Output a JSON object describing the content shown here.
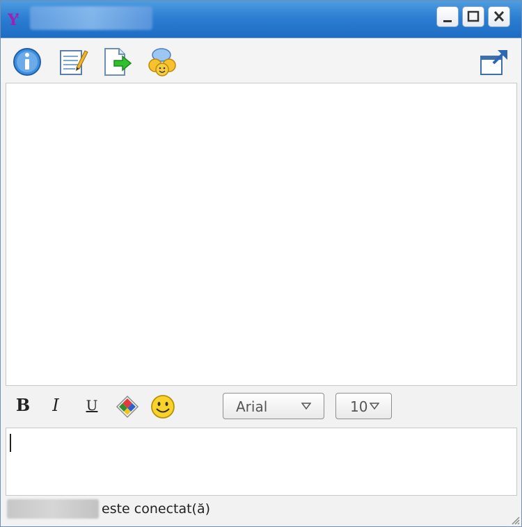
{
  "titlebar": {
    "app_icon": "yahoo-messenger-icon",
    "buttons": [
      "minimize-icon",
      "maximize-icon",
      "close-icon"
    ]
  },
  "toolbar": {
    "icons": [
      "info-icon",
      "edit-notes-icon",
      "send-file-icon",
      "conference-icon",
      "popout-icon"
    ]
  },
  "format": {
    "bold": "B",
    "italic": "I",
    "underline": "U",
    "font_value": "Arial",
    "size_value": "10",
    "icons": [
      "color-icon",
      "smiley-icon"
    ]
  },
  "status": {
    "text": "este conectat(ă)"
  }
}
